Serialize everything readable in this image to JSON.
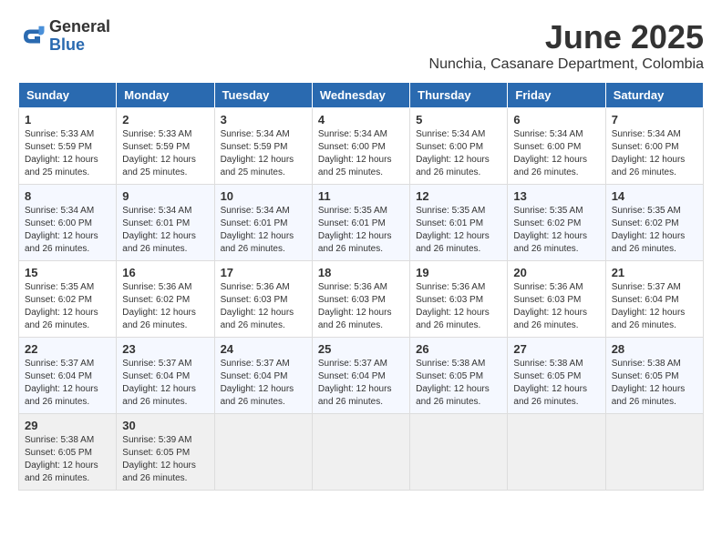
{
  "app": {
    "logo_general": "General",
    "logo_blue": "Blue"
  },
  "header": {
    "month_year": "June 2025",
    "location": "Nunchia, Casanare Department, Colombia"
  },
  "weekdays": [
    "Sunday",
    "Monday",
    "Tuesday",
    "Wednesday",
    "Thursday",
    "Friday",
    "Saturday"
  ],
  "weeks": [
    [
      {
        "day": "1",
        "sunrise": "5:33 AM",
        "sunset": "5:59 PM",
        "daylight": "12 hours and 25 minutes."
      },
      {
        "day": "2",
        "sunrise": "5:33 AM",
        "sunset": "5:59 PM",
        "daylight": "12 hours and 25 minutes."
      },
      {
        "day": "3",
        "sunrise": "5:34 AM",
        "sunset": "5:59 PM",
        "daylight": "12 hours and 25 minutes."
      },
      {
        "day": "4",
        "sunrise": "5:34 AM",
        "sunset": "6:00 PM",
        "daylight": "12 hours and 25 minutes."
      },
      {
        "day": "5",
        "sunrise": "5:34 AM",
        "sunset": "6:00 PM",
        "daylight": "12 hours and 26 minutes."
      },
      {
        "day": "6",
        "sunrise": "5:34 AM",
        "sunset": "6:00 PM",
        "daylight": "12 hours and 26 minutes."
      },
      {
        "day": "7",
        "sunrise": "5:34 AM",
        "sunset": "6:00 PM",
        "daylight": "12 hours and 26 minutes."
      }
    ],
    [
      {
        "day": "8",
        "sunrise": "5:34 AM",
        "sunset": "6:00 PM",
        "daylight": "12 hours and 26 minutes."
      },
      {
        "day": "9",
        "sunrise": "5:34 AM",
        "sunset": "6:01 PM",
        "daylight": "12 hours and 26 minutes."
      },
      {
        "day": "10",
        "sunrise": "5:34 AM",
        "sunset": "6:01 PM",
        "daylight": "12 hours and 26 minutes."
      },
      {
        "day": "11",
        "sunrise": "5:35 AM",
        "sunset": "6:01 PM",
        "daylight": "12 hours and 26 minutes."
      },
      {
        "day": "12",
        "sunrise": "5:35 AM",
        "sunset": "6:01 PM",
        "daylight": "12 hours and 26 minutes."
      },
      {
        "day": "13",
        "sunrise": "5:35 AM",
        "sunset": "6:02 PM",
        "daylight": "12 hours and 26 minutes."
      },
      {
        "day": "14",
        "sunrise": "5:35 AM",
        "sunset": "6:02 PM",
        "daylight": "12 hours and 26 minutes."
      }
    ],
    [
      {
        "day": "15",
        "sunrise": "5:35 AM",
        "sunset": "6:02 PM",
        "daylight": "12 hours and 26 minutes."
      },
      {
        "day": "16",
        "sunrise": "5:36 AM",
        "sunset": "6:02 PM",
        "daylight": "12 hours and 26 minutes."
      },
      {
        "day": "17",
        "sunrise": "5:36 AM",
        "sunset": "6:03 PM",
        "daylight": "12 hours and 26 minutes."
      },
      {
        "day": "18",
        "sunrise": "5:36 AM",
        "sunset": "6:03 PM",
        "daylight": "12 hours and 26 minutes."
      },
      {
        "day": "19",
        "sunrise": "5:36 AM",
        "sunset": "6:03 PM",
        "daylight": "12 hours and 26 minutes."
      },
      {
        "day": "20",
        "sunrise": "5:36 AM",
        "sunset": "6:03 PM",
        "daylight": "12 hours and 26 minutes."
      },
      {
        "day": "21",
        "sunrise": "5:37 AM",
        "sunset": "6:04 PM",
        "daylight": "12 hours and 26 minutes."
      }
    ],
    [
      {
        "day": "22",
        "sunrise": "5:37 AM",
        "sunset": "6:04 PM",
        "daylight": "12 hours and 26 minutes."
      },
      {
        "day": "23",
        "sunrise": "5:37 AM",
        "sunset": "6:04 PM",
        "daylight": "12 hours and 26 minutes."
      },
      {
        "day": "24",
        "sunrise": "5:37 AM",
        "sunset": "6:04 PM",
        "daylight": "12 hours and 26 minutes."
      },
      {
        "day": "25",
        "sunrise": "5:37 AM",
        "sunset": "6:04 PM",
        "daylight": "12 hours and 26 minutes."
      },
      {
        "day": "26",
        "sunrise": "5:38 AM",
        "sunset": "6:05 PM",
        "daylight": "12 hours and 26 minutes."
      },
      {
        "day": "27",
        "sunrise": "5:38 AM",
        "sunset": "6:05 PM",
        "daylight": "12 hours and 26 minutes."
      },
      {
        "day": "28",
        "sunrise": "5:38 AM",
        "sunset": "6:05 PM",
        "daylight": "12 hours and 26 minutes."
      }
    ],
    [
      {
        "day": "29",
        "sunrise": "5:38 AM",
        "sunset": "6:05 PM",
        "daylight": "12 hours and 26 minutes."
      },
      {
        "day": "30",
        "sunrise": "5:39 AM",
        "sunset": "6:05 PM",
        "daylight": "12 hours and 26 minutes."
      },
      null,
      null,
      null,
      null,
      null
    ]
  ],
  "labels": {
    "sunrise": "Sunrise:",
    "sunset": "Sunset:",
    "daylight": "Daylight:"
  }
}
